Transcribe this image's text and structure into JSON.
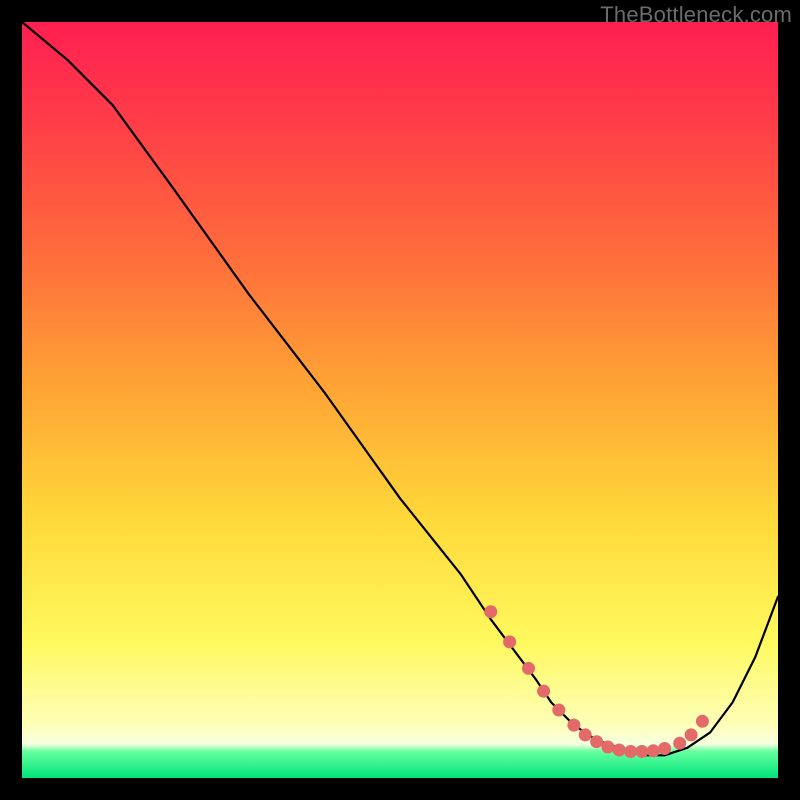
{
  "watermark": "TheBottleneck.com",
  "chart_data": {
    "type": "line",
    "title": "",
    "xlabel": "",
    "ylabel": "",
    "xlim": [
      0,
      100
    ],
    "ylim": [
      0,
      100
    ],
    "series": [
      {
        "name": "curve",
        "x": [
          0,
          6,
          12,
          20,
          30,
          40,
          50,
          58,
          62,
          65,
          68,
          70,
          73,
          76,
          79,
          82,
          85,
          88,
          91,
          94,
          97,
          100
        ],
        "y": [
          100,
          95,
          89,
          78,
          64,
          51,
          37,
          27,
          21,
          17,
          13,
          10,
          7,
          5,
          4,
          3,
          3,
          4,
          6,
          10,
          16,
          24
        ]
      }
    ],
    "markers": {
      "name": "valley-dots",
      "color": "#e46a6a",
      "x": [
        62,
        64.5,
        67,
        69,
        71,
        73,
        74.5,
        76,
        77.5,
        79,
        80.5,
        82,
        83.5,
        85,
        87,
        88.5,
        90
      ],
      "y": [
        22,
        18,
        14.5,
        11.5,
        9,
        7,
        5.7,
        4.8,
        4.1,
        3.7,
        3.5,
        3.5,
        3.6,
        3.9,
        4.6,
        5.7,
        7.5
      ]
    },
    "background": {
      "direction": "top-to-bottom",
      "stops": [
        {
          "pos": 0.0,
          "color": "#ff1f52"
        },
        {
          "pos": 0.3,
          "color": "#ff6a3c"
        },
        {
          "pos": 0.66,
          "color": "#ffd93a"
        },
        {
          "pos": 0.93,
          "color": "#feffb8"
        },
        {
          "pos": 0.97,
          "color": "#66ffa0"
        },
        {
          "pos": 1.0,
          "color": "#00e47a"
        }
      ]
    }
  }
}
